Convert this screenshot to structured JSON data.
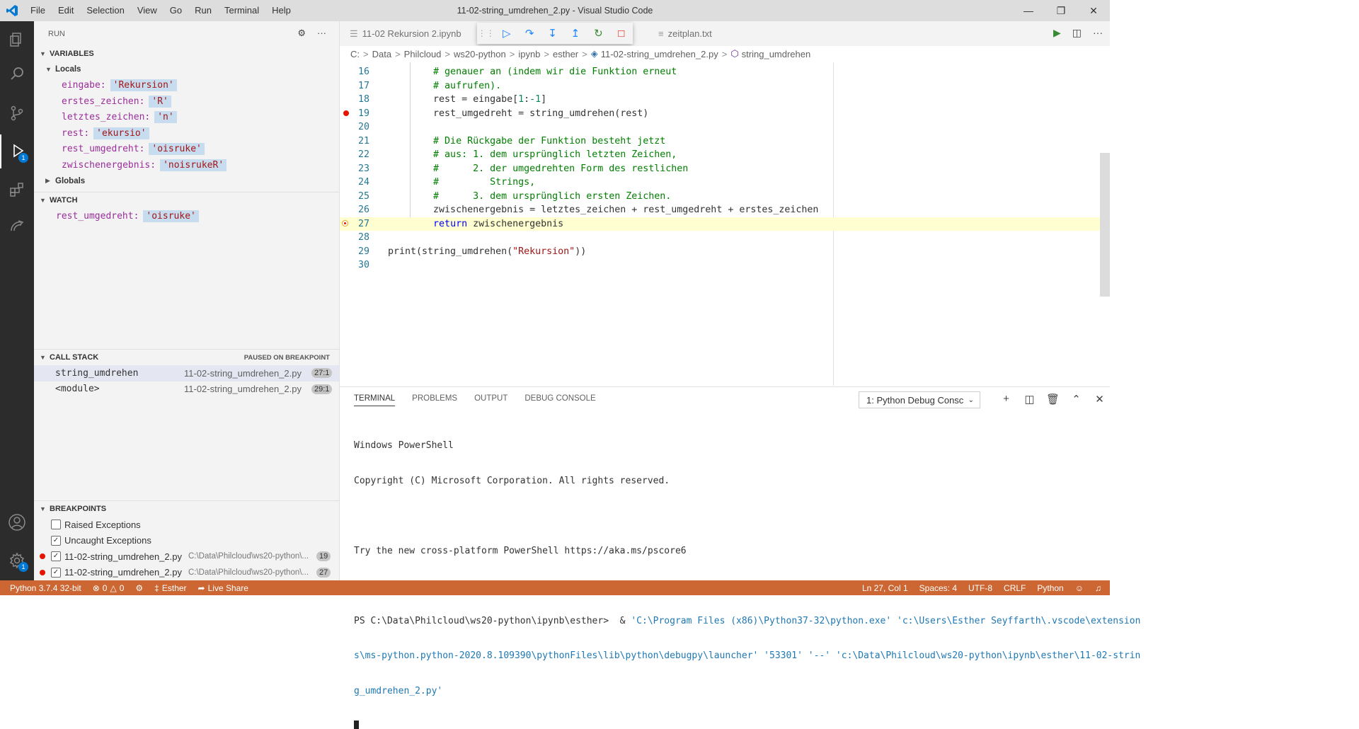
{
  "menu": [
    "File",
    "Edit",
    "Selection",
    "View",
    "Go",
    "Run",
    "Terminal",
    "Help"
  ],
  "window_title": "11-02-string_umdrehen_2.py - Visual Studio Code",
  "sidebar": {
    "title": "RUN",
    "variables_title": "VARIABLES",
    "locals_title": "Locals",
    "locals": [
      {
        "name": "eingabe",
        "value": "'Rekursion'"
      },
      {
        "name": "erstes_zeichen",
        "value": "'R'"
      },
      {
        "name": "letztes_zeichen",
        "value": "'n'"
      },
      {
        "name": "rest",
        "value": "'ekursio'"
      },
      {
        "name": "rest_umgedreht",
        "value": "'oisruke'"
      },
      {
        "name": "zwischenergebnis",
        "value": "'noisrukeR'"
      }
    ],
    "globals_title": "Globals",
    "watch_title": "WATCH",
    "watch": [
      {
        "name": "rest_umgedreht",
        "value": "'oisruke'"
      }
    ],
    "callstack_title": "CALL STACK",
    "callstack_status": "PAUSED ON BREAKPOINT",
    "callstack": [
      {
        "fn": "string_umdrehen",
        "file": "11-02-string_umdrehen_2.py",
        "pos": "27:1"
      },
      {
        "fn": "<module>",
        "file": "11-02-string_umdrehen_2.py",
        "pos": "29:1"
      }
    ],
    "breakpoints_title": "BREAKPOINTS",
    "exceptions": [
      {
        "label": "Raised Exceptions",
        "checked": false
      },
      {
        "label": "Uncaught Exceptions",
        "checked": true
      }
    ],
    "breakpoints": [
      {
        "file": "11-02-string_umdrehen_2.py",
        "path": "C:\\Data\\Philcloud\\ws20-python\\...",
        "line": "19"
      },
      {
        "file": "11-02-string_umdrehen_2.py",
        "path": "C:\\Data\\Philcloud\\ws20-python\\...",
        "line": "27"
      }
    ]
  },
  "tabs": [
    {
      "label": "11-02 Rekursion 2.ipynb"
    },
    {
      "label": "zeitplan.txt"
    }
  ],
  "breadcrumb": [
    "C:",
    "Data",
    "Philcloud",
    "ws20-python",
    "ipynb",
    "esther",
    "11-02-string_umdrehen_2.py",
    "string_umdrehen"
  ],
  "code_lines": [
    {
      "n": "16",
      "t": "        # genauer an (indem wir die Funktion erneut",
      "k": "cmt"
    },
    {
      "n": "17",
      "t": "        # aufrufen).",
      "k": "cmt"
    },
    {
      "n": "18",
      "t": "        rest = eingabe[1:-1]",
      "k": "plain"
    },
    {
      "n": "19",
      "t": "        rest_umgedreht = string_umdrehen(rest)",
      "k": "plain"
    },
    {
      "n": "20",
      "t": "",
      "k": "plain"
    },
    {
      "n": "21",
      "t": "        # Die Rückgabe der Funktion besteht jetzt",
      "k": "cmt"
    },
    {
      "n": "22",
      "t": "        # aus: 1. dem ursprünglich letzten Zeichen,",
      "k": "cmt"
    },
    {
      "n": "23",
      "t": "        #      2. der umgedrehten Form des restlichen",
      "k": "cmt"
    },
    {
      "n": "24",
      "t": "        #         Strings,",
      "k": "cmt"
    },
    {
      "n": "25",
      "t": "        #      3. dem ursprünglich ersten Zeichen.",
      "k": "cmt"
    },
    {
      "n": "26",
      "t": "        zwischenergebnis = letztes_zeichen + rest_umgedreht + erstes_zeichen",
      "k": "plain"
    },
    {
      "n": "27",
      "t": "        return zwischenergebnis",
      "k": "ret"
    },
    {
      "n": "28",
      "t": "",
      "k": "plain"
    },
    {
      "n": "29",
      "t": "print(string_umdrehen(\"Rekursion\"))",
      "k": "print"
    },
    {
      "n": "30",
      "t": "",
      "k": "plain"
    }
  ],
  "panel": {
    "tabs": [
      "TERMINAL",
      "PROBLEMS",
      "OUTPUT",
      "DEBUG CONSOLE"
    ],
    "terminal_select": "1: Python Debug Consc",
    "terminal_lines": [
      "Windows PowerShell",
      "Copyright (C) Microsoft Corporation. All rights reserved.",
      "",
      "Try the new cross-platform PowerShell https://aka.ms/pscore6",
      ""
    ],
    "prompt": "PS C:\\Data\\Philcloud\\ws20-python\\ipynb\\esther>  & ",
    "command_1": "'C:\\Program Files (x86)\\Python37-32\\python.exe' 'c:\\Users\\Esther Seyffarth\\.vscode\\extension",
    "command_2": "s\\ms-python.python-2020.8.109390\\pythonFiles\\lib\\python\\debugpy\\launcher' '53301' '--' 'c:\\Data\\Philcloud\\ws20-python\\ipynb\\esther\\11-02-strin",
    "command_3": "g_umdrehen_2.py'"
  },
  "status": {
    "python": "Python 3.7.4 32-bit",
    "errors": "0",
    "warnings": "0",
    "user": "Esther",
    "liveshare": "Live Share",
    "position": "Ln 27, Col 1",
    "spaces": "Spaces: 4",
    "encoding": "UTF-8",
    "eol": "CRLF",
    "language": "Python"
  },
  "colors": {
    "statusbar": "#cc6633",
    "activitybar": "#2c2c2c",
    "current_line": "#fffed0",
    "breakpoint": "#e51400"
  }
}
